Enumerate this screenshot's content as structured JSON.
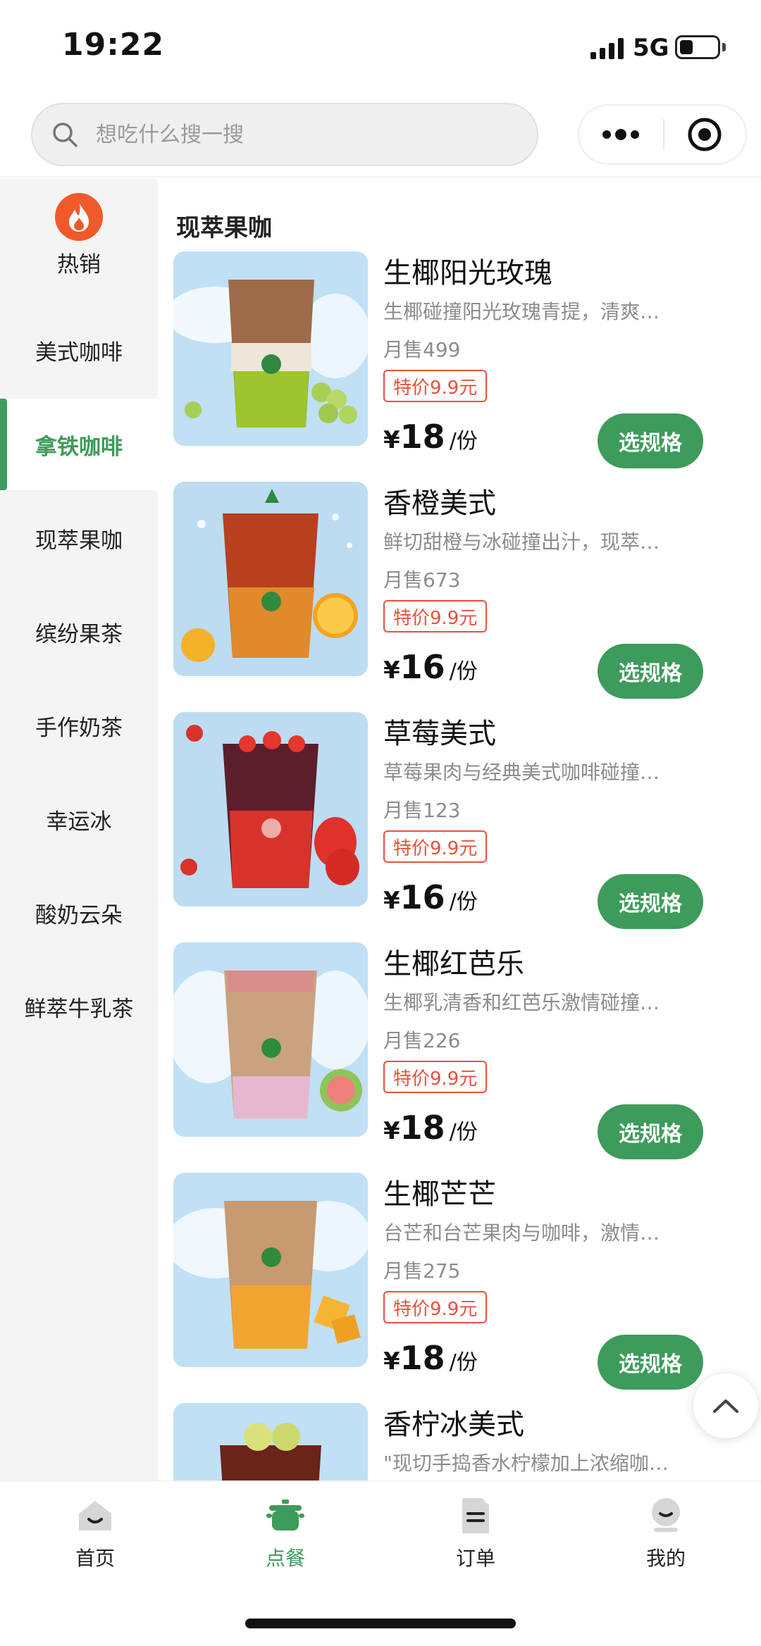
{
  "status_bar": {
    "time": "19:22",
    "network": "5G"
  },
  "search": {
    "placeholder": "想吃什么搜一搜"
  },
  "sidebar": {
    "hot_label": "热销",
    "items": [
      {
        "label": "美式咖啡"
      },
      {
        "label": "拿铁咖啡"
      },
      {
        "label": "现萃果咖"
      },
      {
        "label": "缤纷果茶"
      },
      {
        "label": "手作奶茶"
      },
      {
        "label": "幸运冰"
      },
      {
        "label": "酸奶云朵"
      },
      {
        "label": "鲜萃牛乳茶"
      }
    ],
    "active": "拿铁咖啡"
  },
  "main": {
    "section_title": "现萃果咖",
    "products": [
      {
        "name": "生椰阳光玫瑰",
        "desc": "生椰碰撞阳光玫瑰青提，清爽…",
        "sales": "月售499",
        "badge": "特价9.9元",
        "currency": "¥",
        "price": "18",
        "unit": "/份",
        "button": "选规格"
      },
      {
        "name": "香橙美式",
        "desc": "鲜切甜橙与冰碰撞出汁，现萃…",
        "sales": "月售673",
        "badge": "特价9.9元",
        "currency": "¥",
        "price": "16",
        "unit": "/份",
        "button": "选规格"
      },
      {
        "name": "草莓美式",
        "desc": "草莓果肉与经典美式咖啡碰撞…",
        "sales": "月售123",
        "badge": "特价9.9元",
        "currency": "¥",
        "price": "16",
        "unit": "/份",
        "button": "选规格"
      },
      {
        "name": "生椰红芭乐",
        "desc": "生椰乳清香和红芭乐激情碰撞…",
        "sales": "月售226",
        "badge": "特价9.9元",
        "currency": "¥",
        "price": "18",
        "unit": "/份",
        "button": "选规格"
      },
      {
        "name": "生椰芒芒",
        "desc": "台芒和台芒果肉与咖啡，激情…",
        "sales": "月售275",
        "badge": "特价9.9元",
        "currency": "¥",
        "price": "18",
        "unit": "/份",
        "button": "选规格"
      },
      {
        "name": "香柠冰美式",
        "desc": "\"现切手捣香水柠檬加上浓缩咖…"
      }
    ]
  },
  "tabbar": {
    "items": [
      {
        "label": "首页",
        "icon": "home-icon"
      },
      {
        "label": "点餐",
        "icon": "pot-icon"
      },
      {
        "label": "订单",
        "icon": "document-icon"
      },
      {
        "label": "我的",
        "icon": "profile-icon"
      }
    ],
    "active": "点餐"
  },
  "colors": {
    "accent": "#3d9b5b",
    "badge": "#e8513a",
    "hot": "#f05a2a"
  }
}
